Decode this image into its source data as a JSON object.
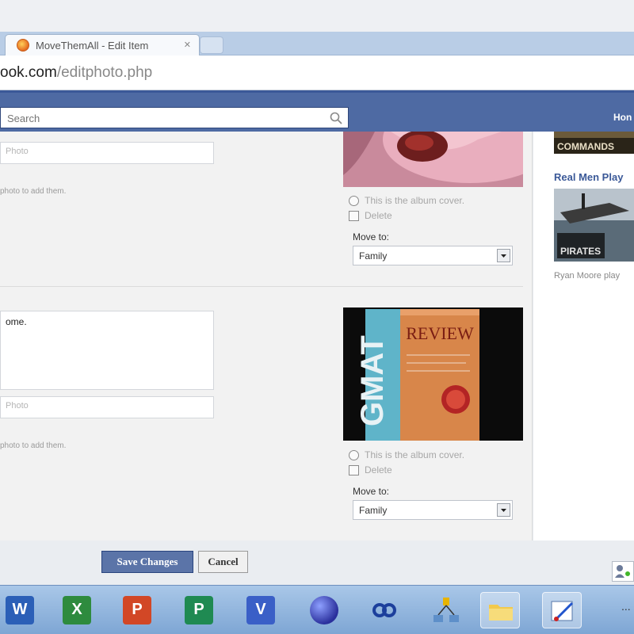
{
  "browser": {
    "tab_title": "MoveThemAll - Edit Item",
    "tab_close": "✕",
    "url_host": "ook.com",
    "url_path": "/editphoto.php"
  },
  "header": {
    "search_placeholder": "Search",
    "home_link": "Hon"
  },
  "photos": [
    {
      "tag_placeholder": "Photo",
      "tag_hint": "photo to add them.",
      "album_cover_label": "This is the album cover.",
      "delete_label": "Delete",
      "move_to_label": "Move to:",
      "move_to_value": "Family"
    },
    {
      "caption": "ome.",
      "tag_placeholder": "Photo",
      "tag_hint": "photo to add them.",
      "album_cover_label": "This is the album cover.",
      "delete_label": "Delete",
      "move_to_label": "Move to:",
      "move_to_value": "Family",
      "book_title": "REVIEW",
      "book_spine": "GMAT"
    }
  ],
  "sidebar": {
    "ad_banner_text": "COMMANDS",
    "ad_title": "Real Men Play",
    "ad_image_text": "PIRATES",
    "ad_text": "Ryan Moore play"
  },
  "actions": {
    "save_label": "Save Changes",
    "cancel_label": "Cancel"
  },
  "taskbar": {
    "word": "W",
    "excel": "X",
    "powerpoint": "P",
    "publisher": "P",
    "visio": "V",
    "more": "..."
  },
  "colors": {
    "fb_blue": "#3b5998",
    "button_blue": "#5b74a8"
  }
}
